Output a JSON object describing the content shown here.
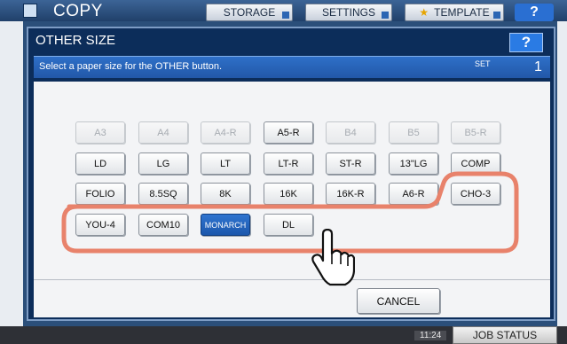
{
  "app": {
    "title": "COPY",
    "tabs": [
      "STORAGE",
      "SETTINGS",
      "TEMPLATE"
    ],
    "help": "?",
    "clock": "11:24",
    "job_status": "JOB STATUS"
  },
  "dialog": {
    "title": "OTHER SIZE",
    "help": "?",
    "message": "Select a paper size for the OTHER button.",
    "set_label": "SET",
    "set_value": "1",
    "cancel": "CANCEL"
  },
  "paper_sizes": {
    "row1": [
      "A3",
      "A4",
      "A4-R",
      "A5-R",
      "B4",
      "B5",
      "B5-R"
    ],
    "row2": [
      "LD",
      "LG",
      "LT",
      "LT-R",
      "ST-R",
      "13\"LG",
      "COMP"
    ],
    "row3": [
      "FOLIO",
      "8.5SQ",
      "8K",
      "16K",
      "16K-R",
      "A6-R",
      "CHO-3"
    ],
    "row4": [
      "YOU-4",
      "COM10",
      "MONARCH",
      "DL"
    ],
    "disabled": [
      "A3",
      "A4",
      "A4-R",
      "B4",
      "B5",
      "B5-R"
    ],
    "selected": "MONARCH"
  },
  "colors": {
    "highlight": "#e8826b",
    "selected": "#1f5db0",
    "dialog_bg": "#0c2d5a"
  }
}
